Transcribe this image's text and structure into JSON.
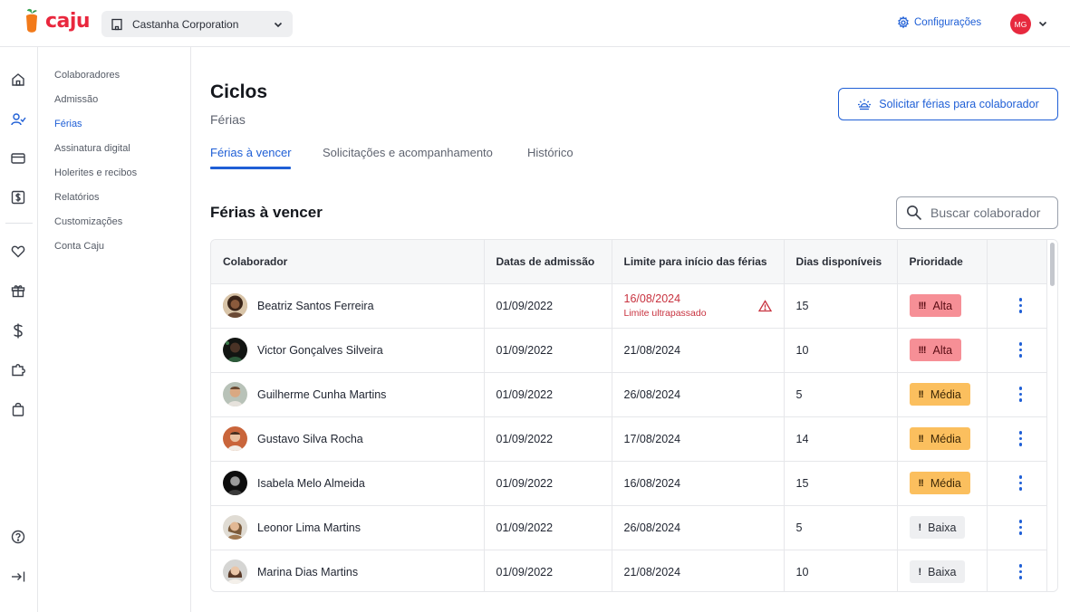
{
  "brand": {
    "name": "caju",
    "color": "#e9273d"
  },
  "company_selector": {
    "value": "Castanha Corporation"
  },
  "header": {
    "settings_label": "Configurações",
    "user_initials": "MG"
  },
  "rail_icons": [
    "home-icon",
    "user-check-icon",
    "card-icon",
    "dollar-box-icon",
    "heart-icon",
    "gift-icon",
    "dollar-icon",
    "puzzle-icon",
    "bag-icon",
    "help-icon",
    "collapse-icon"
  ],
  "subnav": {
    "items": [
      {
        "label": "Colaboradores",
        "active": false
      },
      {
        "label": "Admissão",
        "active": false
      },
      {
        "label": "Férias",
        "active": true
      },
      {
        "label": "Assinatura digital",
        "active": false
      },
      {
        "label": "Holerites e recibos",
        "active": false
      },
      {
        "label": "Relatórios",
        "active": false
      },
      {
        "label": "Customizações",
        "active": false
      },
      {
        "label": "Conta Caju",
        "active": false
      }
    ]
  },
  "page": {
    "title": "Ciclos",
    "subtitle": "Férias",
    "request_button": "Solicitar férias para colaborador",
    "tabs": [
      {
        "label": "Férias à vencer",
        "active": true
      },
      {
        "label": "Solicitações e acompanhamento",
        "active": false
      },
      {
        "label": "Histórico",
        "active": false
      }
    ],
    "section_title": "Férias à vencer",
    "search_placeholder": "Buscar colaborador"
  },
  "table": {
    "headers": [
      "Colaborador",
      "Datas de admissão",
      "Limite para início das férias",
      "Dias disponíveis",
      "Prioridade"
    ],
    "rows": [
      {
        "name": "Beatriz Santos Ferreira",
        "admission": "01/09/2022",
        "limit": "16/08/2024",
        "limit_note": "Limite ultrapassado",
        "days": "15",
        "priority": "Alta",
        "priority_mark": "!!!",
        "level": "alta"
      },
      {
        "name": "Victor Gonçalves Silveira",
        "admission": "01/09/2022",
        "limit": "21/08/2024",
        "limit_note": "",
        "days": "10",
        "priority": "Alta",
        "priority_mark": "!!!",
        "level": "alta"
      },
      {
        "name": "Guilherme Cunha Martins",
        "admission": "01/09/2022",
        "limit": "26/08/2024",
        "limit_note": "",
        "days": "5",
        "priority": "Média",
        "priority_mark": "!!",
        "level": "media"
      },
      {
        "name": "Gustavo Silva Rocha",
        "admission": "01/09/2022",
        "limit": "17/08/2024",
        "limit_note": "",
        "days": "14",
        "priority": "Média",
        "priority_mark": "!!",
        "level": "media"
      },
      {
        "name": "Isabela Melo Almeida",
        "admission": "01/09/2022",
        "limit": "16/08/2024",
        "limit_note": "",
        "days": "15",
        "priority": "Média",
        "priority_mark": "!!",
        "level": "media"
      },
      {
        "name": "Leonor Lima Martins",
        "admission": "01/09/2022",
        "limit": "26/08/2024",
        "limit_note": "",
        "days": "5",
        "priority": "Baixa",
        "priority_mark": "!",
        "level": "baixa"
      },
      {
        "name": "Marina Dias Martins",
        "admission": "01/09/2022",
        "limit": "21/08/2024",
        "limit_note": "",
        "days": "10",
        "priority": "Baixa",
        "priority_mark": "!",
        "level": "baixa"
      }
    ]
  },
  "colors": {
    "accent": "#1f5fd6",
    "alta": "#f68f96",
    "media": "#fbbf5e",
    "baixa": "#eeeff1",
    "warning": "#c8323f"
  }
}
